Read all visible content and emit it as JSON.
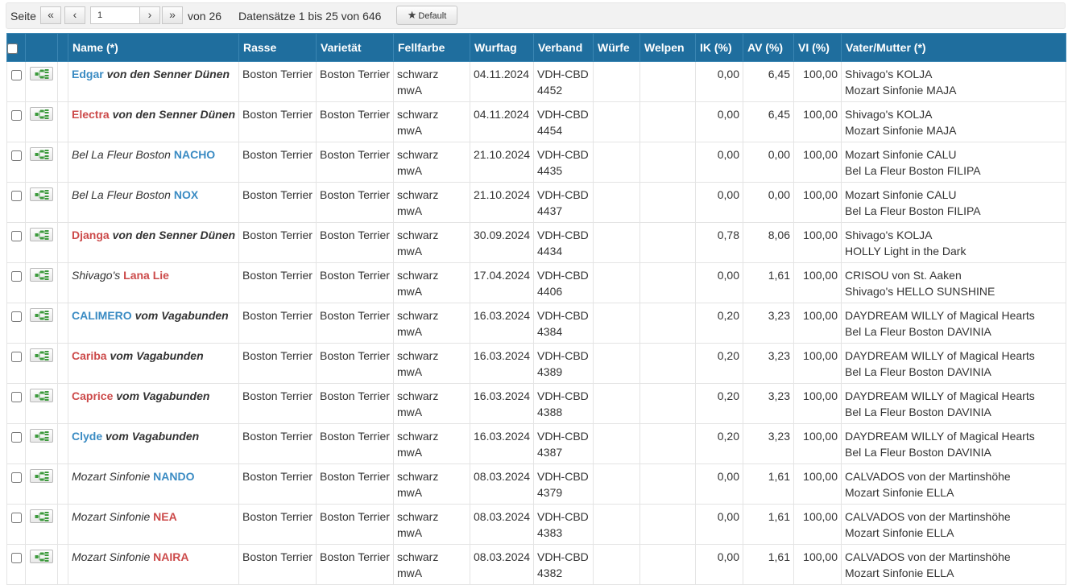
{
  "pager": {
    "page_label": "Seite",
    "page_value": "1",
    "of_label": "von 26",
    "records_label": "Datensätze 1 bis 25 von 646",
    "default_label": "Default",
    "btn_first": "«",
    "btn_prev": "‹",
    "btn_next": "›",
    "btn_last": "»"
  },
  "columns": [
    "Name (*)",
    "Rasse",
    "Varietät",
    "Fellfarbe",
    "Wurftag",
    "Verband",
    "Würfe",
    "Welpen",
    "IK (%)",
    "AV (%)",
    "VI (%)",
    "Vater/Mutter (*)"
  ],
  "colors": {
    "header_bg": "#1f6e9e",
    "male_name": "#3a8bc3",
    "female_name": "#cc4a4a"
  },
  "rows": [
    {
      "prefix": "",
      "call": "Edgar",
      "sex": "m",
      "suffix": "von den Senner Dünen",
      "rasse": "Boston Terrier",
      "varietaet": "Boston Terrier",
      "fellfarbe": "schwarz mwA",
      "wurftag": "04.11.2024",
      "verband": "VDH-CBD",
      "verband_nr": "4452",
      "wuerfe": "",
      "welpen": "",
      "ik": "0,00",
      "av": "6,45",
      "vi": "100,00",
      "vater": "Shivago's KOLJA",
      "mutter": "Mozart Sinfonie MAJA"
    },
    {
      "prefix": "",
      "call": "Electra",
      "sex": "f",
      "suffix": "von den Senner Dünen",
      "rasse": "Boston Terrier",
      "varietaet": "Boston Terrier",
      "fellfarbe": "schwarz mwA",
      "wurftag": "04.11.2024",
      "verband": "VDH-CBD",
      "verband_nr": "4454",
      "wuerfe": "",
      "welpen": "",
      "ik": "0,00",
      "av": "6,45",
      "vi": "100,00",
      "vater": "Shivago's KOLJA",
      "mutter": "Mozart Sinfonie MAJA"
    },
    {
      "prefix": "Bel La Fleur Boston",
      "call": "NACHO",
      "sex": "m",
      "suffix": "",
      "rasse": "Boston Terrier",
      "varietaet": "Boston Terrier",
      "fellfarbe": "schwarz mwA",
      "wurftag": "21.10.2024",
      "verband": "VDH-CBD",
      "verband_nr": "4435",
      "wuerfe": "",
      "welpen": "",
      "ik": "0,00",
      "av": "0,00",
      "vi": "100,00",
      "vater": "Mozart Sinfonie CALU",
      "mutter": "Bel La Fleur Boston FILIPA"
    },
    {
      "prefix": "Bel La Fleur Boston",
      "call": "NOX",
      "sex": "m",
      "suffix": "",
      "rasse": "Boston Terrier",
      "varietaet": "Boston Terrier",
      "fellfarbe": "schwarz mwA",
      "wurftag": "21.10.2024",
      "verband": "VDH-CBD",
      "verband_nr": "4437",
      "wuerfe": "",
      "welpen": "",
      "ik": "0,00",
      "av": "0,00",
      "vi": "100,00",
      "vater": "Mozart Sinfonie CALU",
      "mutter": "Bel La Fleur Boston FILIPA"
    },
    {
      "prefix": "",
      "call": "Djanga",
      "sex": "f",
      "suffix": "von den Senner Dünen",
      "rasse": "Boston Terrier",
      "varietaet": "Boston Terrier",
      "fellfarbe": "schwarz mwA",
      "wurftag": "30.09.2024",
      "verband": "VDH-CBD",
      "verband_nr": "4434",
      "wuerfe": "",
      "welpen": "",
      "ik": "0,78",
      "av": "8,06",
      "vi": "100,00",
      "vater": "Shivago's KOLJA",
      "mutter": "HOLLY Light in the Dark"
    },
    {
      "prefix": "Shivago's",
      "call": "Lana Lie",
      "sex": "f",
      "suffix": "",
      "rasse": "Boston Terrier",
      "varietaet": "Boston Terrier",
      "fellfarbe": "schwarz mwA",
      "wurftag": "17.04.2024",
      "verband": "VDH-CBD",
      "verband_nr": "4406",
      "wuerfe": "",
      "welpen": "",
      "ik": "0,00",
      "av": "1,61",
      "vi": "100,00",
      "vater": "CRISOU von St. Aaken",
      "mutter": "Shivago's HELLO SUNSHINE"
    },
    {
      "prefix": "",
      "call": "CALIMERO",
      "sex": "m",
      "suffix": "vom Vagabunden",
      "rasse": "Boston Terrier",
      "varietaet": "Boston Terrier",
      "fellfarbe": "schwarz mwA",
      "wurftag": "16.03.2024",
      "verband": "VDH-CBD",
      "verband_nr": "4384",
      "wuerfe": "",
      "welpen": "",
      "ik": "0,20",
      "av": "3,23",
      "vi": "100,00",
      "vater": "DAYDREAM WILLY of Magical Hearts",
      "mutter": "Bel La Fleur Boston DAVINIA"
    },
    {
      "prefix": "",
      "call": "Cariba",
      "sex": "f",
      "suffix": "vom Vagabunden",
      "rasse": "Boston Terrier",
      "varietaet": "Boston Terrier",
      "fellfarbe": "schwarz mwA",
      "wurftag": "16.03.2024",
      "verband": "VDH-CBD",
      "verband_nr": "4389",
      "wuerfe": "",
      "welpen": "",
      "ik": "0,20",
      "av": "3,23",
      "vi": "100,00",
      "vater": "DAYDREAM WILLY of Magical Hearts",
      "mutter": "Bel La Fleur Boston DAVINIA"
    },
    {
      "prefix": "",
      "call": "Caprice",
      "sex": "f",
      "suffix": "vom Vagabunden",
      "rasse": "Boston Terrier",
      "varietaet": "Boston Terrier",
      "fellfarbe": "schwarz mwA",
      "wurftag": "16.03.2024",
      "verband": "VDH-CBD",
      "verband_nr": "4388",
      "wuerfe": "",
      "welpen": "",
      "ik": "0,20",
      "av": "3,23",
      "vi": "100,00",
      "vater": "DAYDREAM WILLY of Magical Hearts",
      "mutter": "Bel La Fleur Boston DAVINIA"
    },
    {
      "prefix": "",
      "call": "Clyde",
      "sex": "m",
      "suffix": "vom Vagabunden",
      "rasse": "Boston Terrier",
      "varietaet": "Boston Terrier",
      "fellfarbe": "schwarz mwA",
      "wurftag": "16.03.2024",
      "verband": "VDH-CBD",
      "verband_nr": "4387",
      "wuerfe": "",
      "welpen": "",
      "ik": "0,20",
      "av": "3,23",
      "vi": "100,00",
      "vater": "DAYDREAM WILLY of Magical Hearts",
      "mutter": "Bel La Fleur Boston DAVINIA"
    },
    {
      "prefix": "Mozart Sinfonie",
      "call": "NANDO",
      "sex": "m",
      "suffix": "",
      "rasse": "Boston Terrier",
      "varietaet": "Boston Terrier",
      "fellfarbe": "schwarz mwA",
      "wurftag": "08.03.2024",
      "verband": "VDH-CBD",
      "verband_nr": "4379",
      "wuerfe": "",
      "welpen": "",
      "ik": "0,00",
      "av": "1,61",
      "vi": "100,00",
      "vater": "CALVADOS von der Martinshöhe",
      "mutter": "Mozart Sinfonie ELLA"
    },
    {
      "prefix": "Mozart Sinfonie",
      "call": "NEA",
      "sex": "f",
      "suffix": "",
      "rasse": "Boston Terrier",
      "varietaet": "Boston Terrier",
      "fellfarbe": "schwarz mwA",
      "wurftag": "08.03.2024",
      "verband": "VDH-CBD",
      "verband_nr": "4383",
      "wuerfe": "",
      "welpen": "",
      "ik": "0,00",
      "av": "1,61",
      "vi": "100,00",
      "vater": "CALVADOS von der Martinshöhe",
      "mutter": "Mozart Sinfonie ELLA"
    },
    {
      "prefix": "Mozart Sinfonie",
      "call": "NAIRA",
      "sex": "f",
      "suffix": "",
      "rasse": "Boston Terrier",
      "varietaet": "Boston Terrier",
      "fellfarbe": "schwarz mwA",
      "wurftag": "08.03.2024",
      "verband": "VDH-CBD",
      "verband_nr": "4382",
      "wuerfe": "",
      "welpen": "",
      "ik": "0,00",
      "av": "1,61",
      "vi": "100,00",
      "vater": "CALVADOS von der Martinshöhe",
      "mutter": "Mozart Sinfonie ELLA"
    }
  ]
}
